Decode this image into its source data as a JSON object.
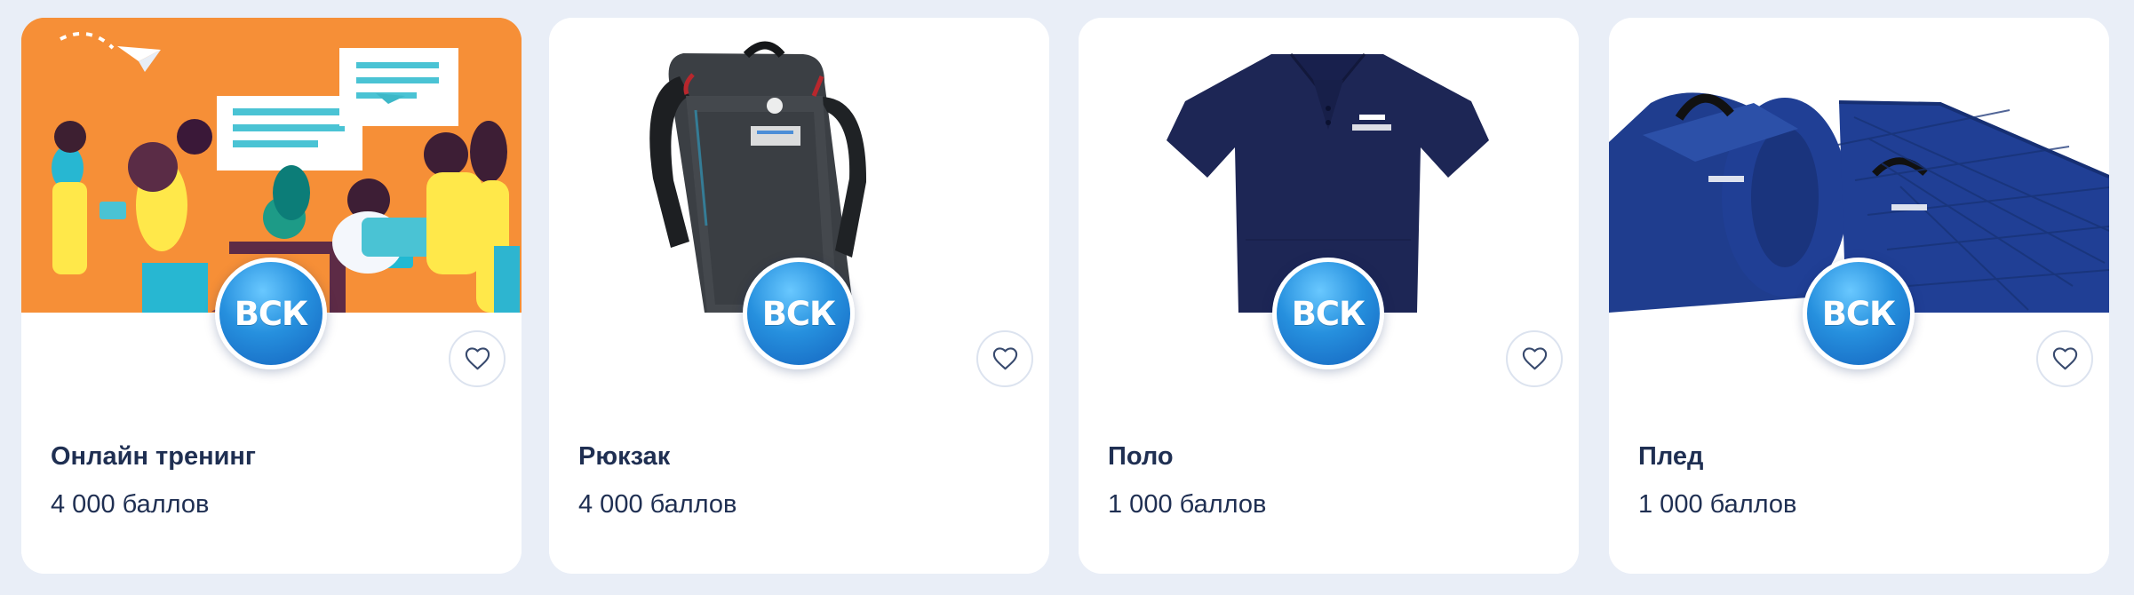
{
  "colors": {
    "page_background": "#e9eef7",
    "card_background": "#ffffff",
    "text": "#1f2f52",
    "brand_blue": "#1b78d2"
  },
  "brand": {
    "label": "ВСК"
  },
  "products": [
    {
      "title": "Онлайн тренинг",
      "price": "4 000 баллов",
      "image_icon": "online-training-illustration-icon"
    },
    {
      "title": "Рюкзак",
      "price": "4 000 баллов",
      "image_icon": "backpack-icon"
    },
    {
      "title": "Поло",
      "price": "1 000 баллов",
      "image_icon": "polo-shirt-icon"
    },
    {
      "title": "Плед",
      "price": "1 000 баллов",
      "image_icon": "blanket-icon"
    }
  ]
}
